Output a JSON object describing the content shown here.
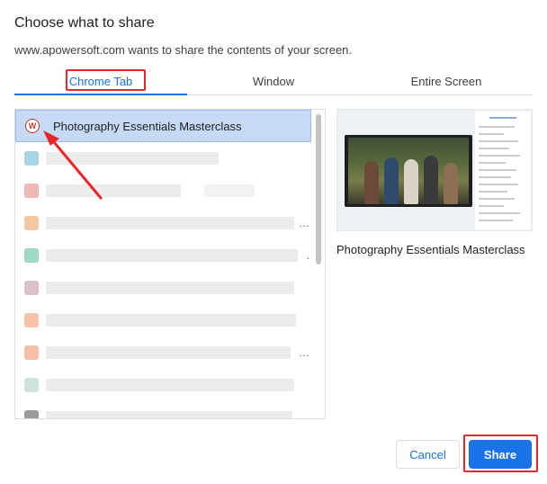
{
  "dialog": {
    "title": "Choose what to share",
    "subtitle": "www.apowersoft.com wants to share the contents of your screen."
  },
  "tabs": [
    {
      "label": "Chrome Tab",
      "active": true
    },
    {
      "label": "Window",
      "active": false
    },
    {
      "label": "Entire Screen",
      "active": false
    }
  ],
  "tab_list": {
    "selected": {
      "title": "Photography Essentials Masterclass",
      "favicon_letter": "W"
    },
    "blurred_row_count": 9
  },
  "preview": {
    "caption": "Photography Essentials Masterclass"
  },
  "buttons": {
    "cancel": "Cancel",
    "share": "Share"
  },
  "colors": {
    "accent": "#1a73e8",
    "selected_row": "#c6d9f5",
    "annotation_red": "#e8262a"
  },
  "icons": {
    "favicon": "circle-w-icon",
    "annotation": "red-arrow-icon"
  }
}
